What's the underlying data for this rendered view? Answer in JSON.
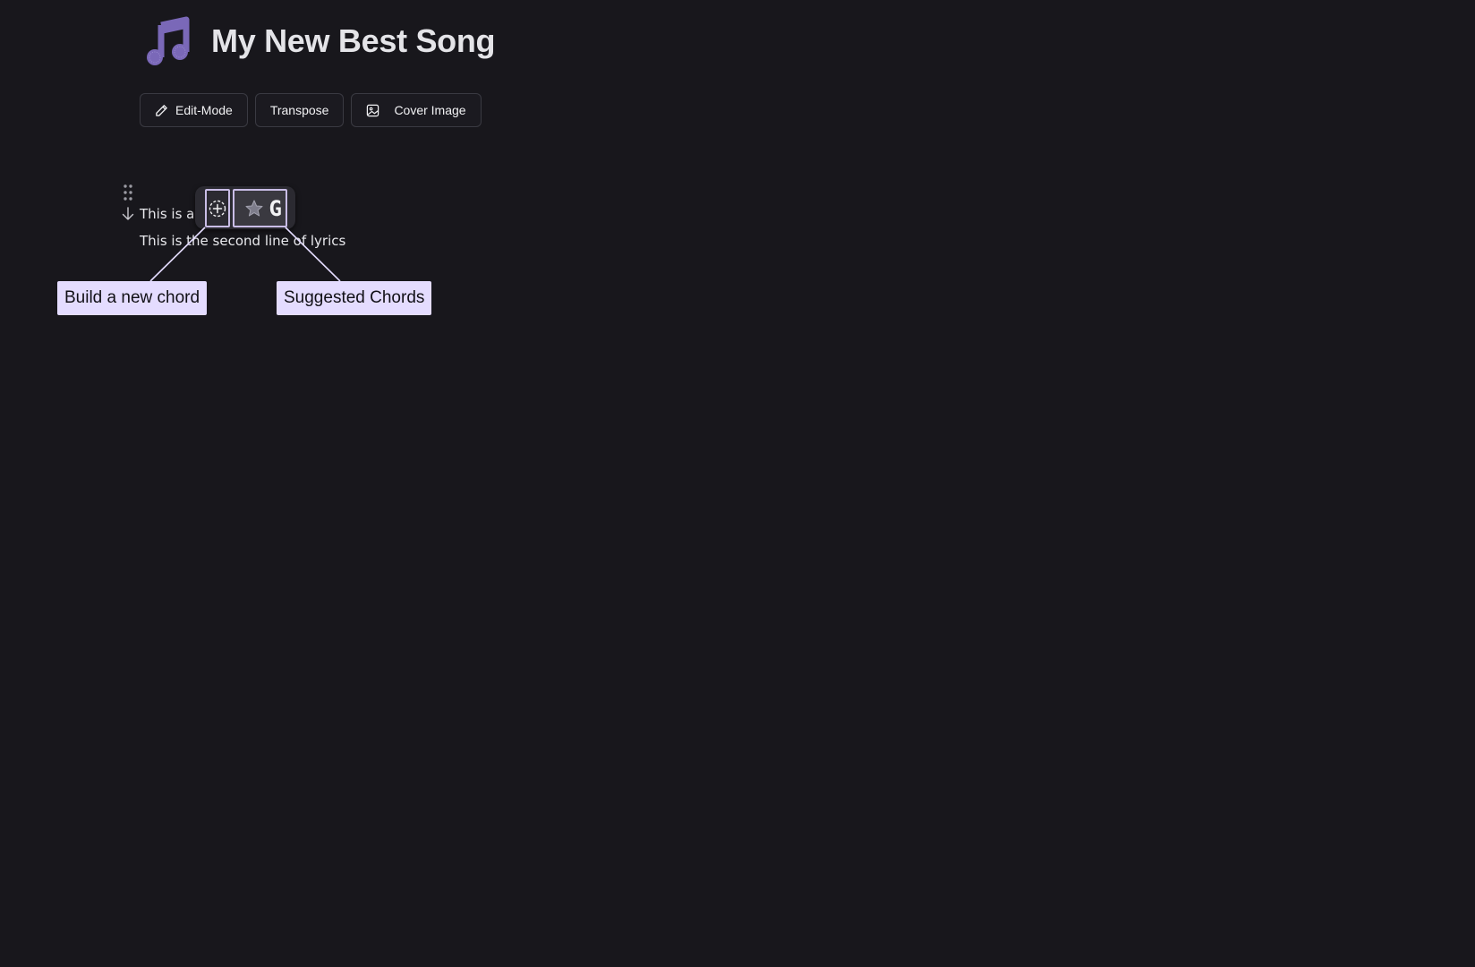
{
  "song": {
    "title": "My New Best Song"
  },
  "toolbar": {
    "edit_mode_label": "Edit-Mode",
    "transpose_label": "Transpose",
    "cover_image_label": "Cover Image"
  },
  "lyrics": {
    "line1": "This is a l",
    "line2": "This is the second line of lyrics"
  },
  "chord_popup": {
    "suggested_chord": "G"
  },
  "callouts": {
    "build_chord": "Build a new chord",
    "suggested_chords": "Suggested Chords"
  },
  "colors": {
    "background": "#18171c",
    "accent": "#7a68b8",
    "callout_bg": "#e4dcff",
    "highlight_border": "#c9bde6"
  },
  "icons": {
    "title": "music-note-icon",
    "edit": "pencil-icon",
    "cover": "image-icon",
    "drag": "drag-handle-icon",
    "collapse": "arrow-down-icon",
    "add": "add-chord-icon",
    "suggested": "star-icon"
  }
}
